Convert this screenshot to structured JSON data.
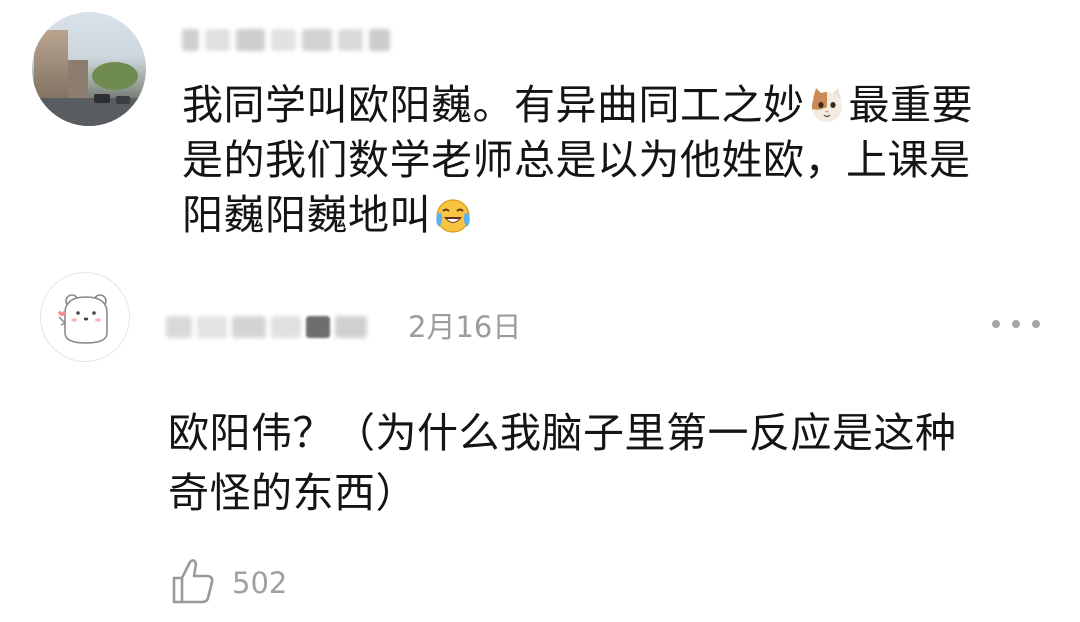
{
  "comments": [
    {
      "author_name": "",
      "text_lines": [
        "我同学叫欧阳巍。有异曲同工之妙",
        "最重要",
        "是的我们数学老师总是以为他姓欧，上课是",
        "阳巍阳巍地叫"
      ],
      "emojis": [
        "cat-face-icon",
        "laughing-crying-icon"
      ]
    },
    {
      "author_name": "",
      "date": "2月16日",
      "text_lines": [
        "欧阳伟？（为什么我脑子里第一反应是这种",
        "奇怪的东西）"
      ],
      "likes": "502",
      "icons": [
        "bear-avatar-icon",
        "more-dots-icon",
        "thumbs-up-icon"
      ]
    }
  ],
  "colors": {
    "text": "#141414",
    "meta_gray": "#9c9c9c",
    "icon_gray": "#a6a6a6"
  }
}
